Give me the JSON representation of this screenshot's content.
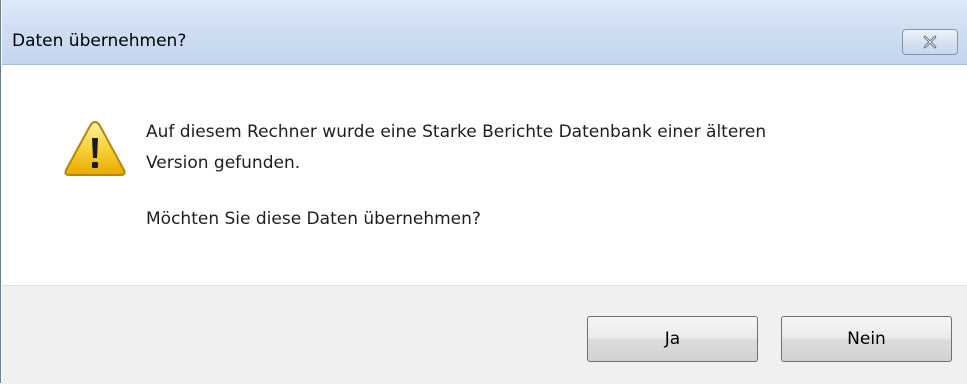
{
  "dialog": {
    "title": "Daten übernehmen?",
    "close_icon": "close-icon",
    "warning_icon": "warning-icon",
    "message_line1": "Auf diesem Rechner wurde eine Starke Berichte Datenbank einer älteren",
    "message_line2": "Version gefunden.",
    "question": "Möchten Sie diese Daten übernehmen?",
    "buttons": {
      "yes_label": "Ja",
      "no_label": "Nein"
    }
  },
  "colors": {
    "titlebar": "#cfdff2",
    "footer": "#f0f0f0",
    "warning": "#f5c518"
  }
}
